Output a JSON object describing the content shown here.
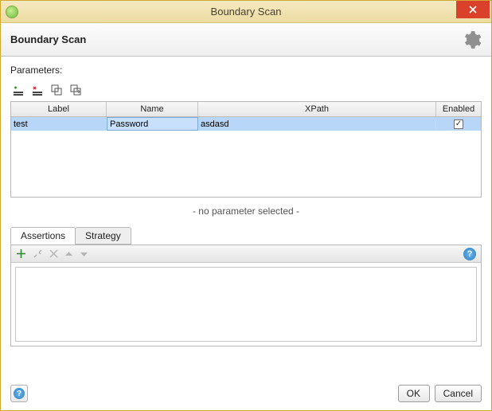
{
  "window": {
    "title": "Boundary Scan"
  },
  "header": {
    "title": "Boundary Scan"
  },
  "parameters": {
    "label": "Parameters:",
    "columns": [
      "Label",
      "Name",
      "XPath",
      "Enabled"
    ],
    "rows": [
      {
        "label": "test",
        "name": "Password",
        "xpath": "asdasd",
        "enabled": true
      }
    ],
    "no_selection": "- no parameter selected -"
  },
  "tabs": [
    {
      "label": "Assertions",
      "active": true
    },
    {
      "label": "Strategy",
      "active": false
    }
  ],
  "footer": {
    "ok": "OK",
    "cancel": "Cancel"
  }
}
